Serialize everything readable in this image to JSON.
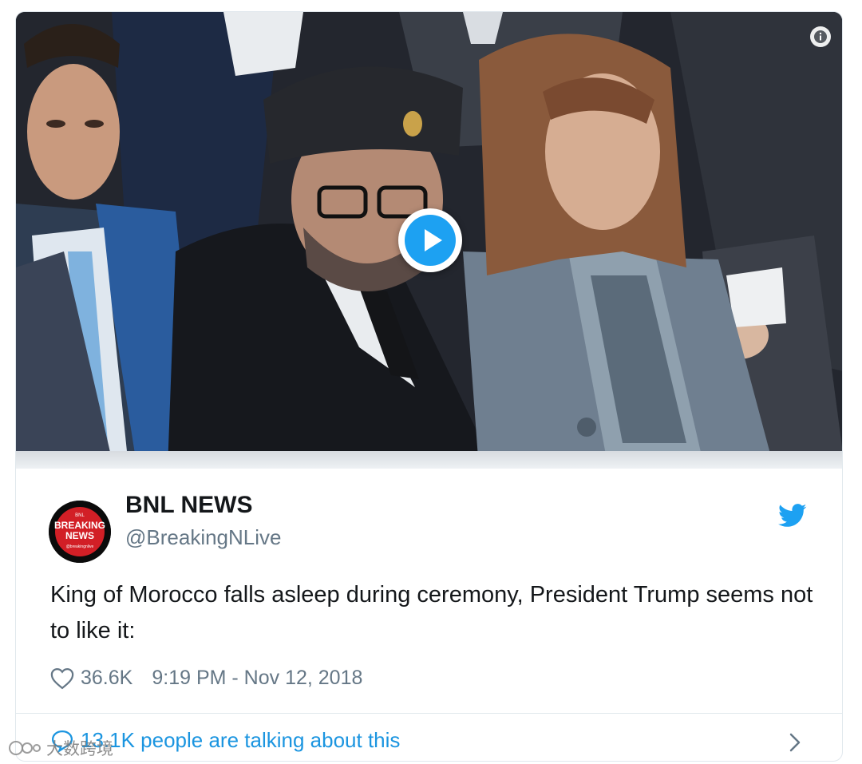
{
  "tweet": {
    "author_name": "BNL NEWS",
    "author_handle": "@BreakingNLive",
    "avatar": {
      "line1": "BNL",
      "line2": "BREAKING",
      "line3": "NEWS",
      "line4": "@breakingnlive"
    },
    "text": "King of Morocco falls asleep during ceremony, President Trump seems not to like it:",
    "likes": "36.6K",
    "timestamp": "9:19 PM - Nov 12, 2018",
    "talking": "13.1K people are talking about this"
  },
  "video": {
    "play_icon": "play-icon",
    "info_icon": "info-icon"
  },
  "watermark": {
    "text": "大数跨境"
  },
  "colors": {
    "accent": "#1b95e0",
    "text_primary": "#14171a",
    "text_secondary": "#657786",
    "border": "#e1e8ed",
    "twitter_blue": "#1da1f2"
  }
}
